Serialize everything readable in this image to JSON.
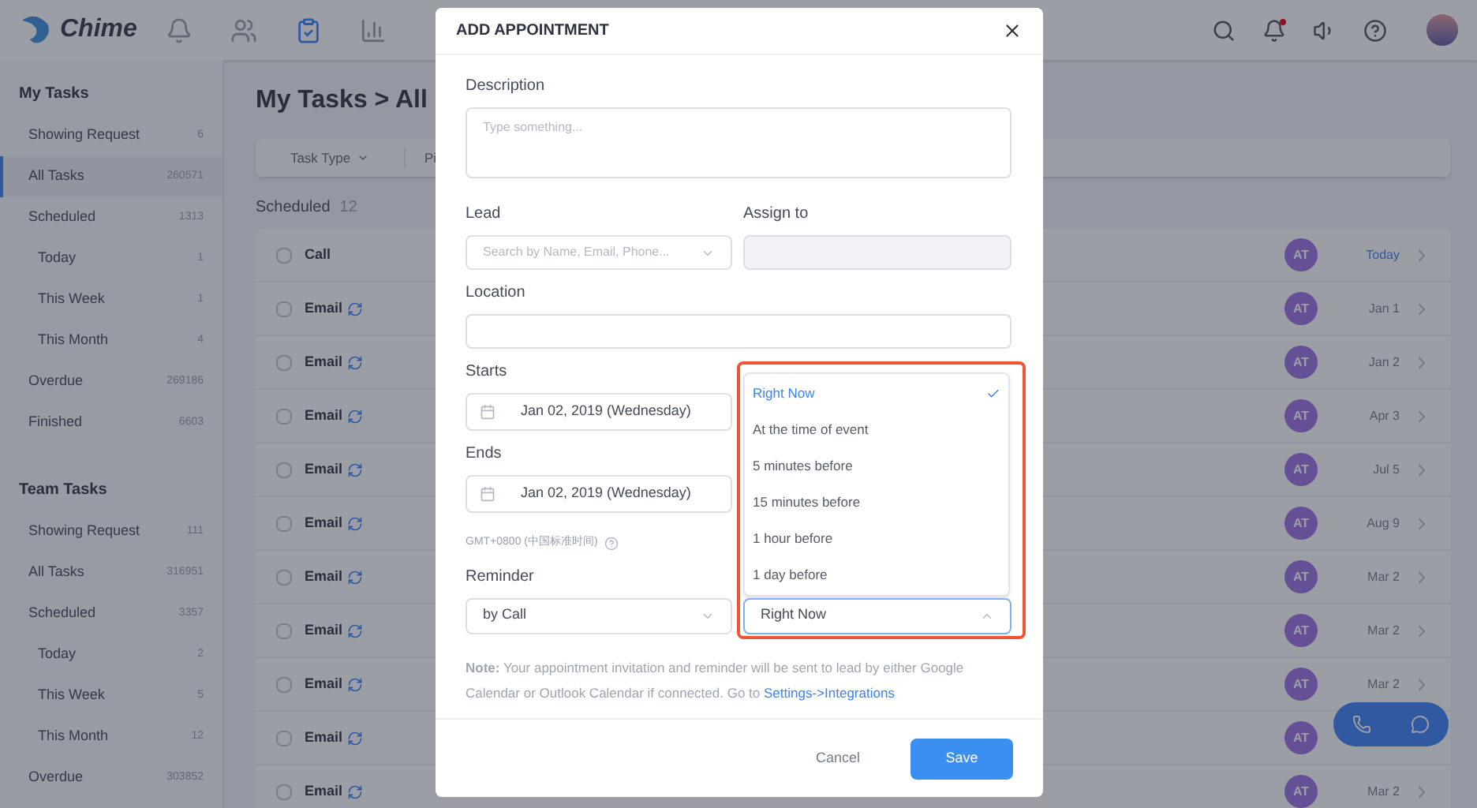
{
  "app": {
    "logo": "Chime",
    "nav": [
      {
        "selected": false
      },
      {
        "selected": false
      },
      {
        "selected": true
      },
      {
        "selected": false
      }
    ],
    "has_unread_notifications": true
  },
  "sidebar": [
    {
      "title": "My Tasks",
      "items": [
        {
          "label": "Showing Request",
          "count": "6",
          "selected": false
        },
        {
          "label": "All Tasks",
          "count": "260571",
          "selected": true
        },
        {
          "label": "Scheduled",
          "count": "1313",
          "selected": false,
          "children": [
            {
              "label": "Today",
              "count": "1",
              "selected": false
            },
            {
              "label": "This Week",
              "count": "1",
              "selected": false
            },
            {
              "label": "This Month",
              "count": "4",
              "selected": false
            }
          ]
        },
        {
          "label": "Overdue",
          "count": "269186",
          "selected": false
        },
        {
          "label": "Finished",
          "count": "6603",
          "selected": false
        }
      ]
    },
    {
      "title": "Team Tasks",
      "items": [
        {
          "label": "Showing Request",
          "count": "111",
          "selected": false
        },
        {
          "label": "All Tasks",
          "count": "316951",
          "selected": false
        },
        {
          "label": "Scheduled",
          "count": "3357",
          "selected": false,
          "children": [
            {
              "label": "Today",
              "count": "2",
              "selected": false
            },
            {
              "label": "This Week",
              "count": "5",
              "selected": false
            },
            {
              "label": "This Month",
              "count": "12",
              "selected": false
            }
          ]
        },
        {
          "label": "Overdue",
          "count": "303852",
          "selected": false
        }
      ]
    }
  ],
  "main": {
    "title": "My Tasks > All",
    "filters": [
      "Task Type",
      "Pi"
    ],
    "group": {
      "label": "Scheduled",
      "count": "12"
    },
    "rows": [
      {
        "type": "Call",
        "checked": false,
        "synced": false,
        "assignee": "AT",
        "date": "Today",
        "highlight": true
      },
      {
        "type": "Email",
        "checked": false,
        "synced": true,
        "assignee": "AT",
        "date": "Jan 1",
        "highlight": false
      },
      {
        "type": "Email",
        "checked": false,
        "synced": true,
        "assignee": "AT",
        "date": "Jan 2",
        "highlight": false
      },
      {
        "type": "Email",
        "checked": false,
        "synced": true,
        "assignee": "AT",
        "date": "Apr 3",
        "highlight": false
      },
      {
        "type": "Email",
        "checked": false,
        "synced": true,
        "assignee": "AT",
        "date": "Jul 5",
        "highlight": false
      },
      {
        "type": "Email",
        "checked": false,
        "synced": true,
        "assignee": "AT",
        "date": "Aug 9",
        "highlight": false
      },
      {
        "type": "Email",
        "checked": false,
        "synced": true,
        "assignee": "AT",
        "date": "Mar 2",
        "highlight": false
      },
      {
        "type": "Email",
        "checked": false,
        "synced": true,
        "assignee": "AT",
        "date": "Mar 2",
        "highlight": false
      },
      {
        "type": "Email",
        "checked": false,
        "synced": true,
        "assignee": "AT",
        "date": "Mar 2",
        "highlight": false
      },
      {
        "type": "Email",
        "checked": false,
        "synced": true,
        "assignee": "AT"
      },
      {
        "type": "Email",
        "checked": false,
        "synced": true,
        "assignee": "AT",
        "date": "Mar 2",
        "highlight": false
      }
    ]
  },
  "modal": {
    "title": "ADD APPOINTMENT",
    "description": {
      "label": "Description",
      "placeholder": "Type something..."
    },
    "lead": {
      "label": "Lead",
      "placeholder": "Search by Name, Email, Phone..."
    },
    "assign_to": {
      "label": "Assign to",
      "disabled": true
    },
    "location": {
      "label": "Location"
    },
    "starts": {
      "label": "Starts",
      "value": "Jan 02, 2019 (Wednesday)"
    },
    "ends": {
      "label": "Ends",
      "value": "Jan 02, 2019 (Wednesday)"
    },
    "timezone": "GMT+0800 (中国标准时间)",
    "reminder": {
      "label": "Reminder",
      "method": "by Call",
      "timing": "Right Now",
      "expanded": true,
      "options": [
        {
          "label": "Right Now",
          "selected": true
        },
        {
          "label": "At the time of event",
          "selected": false
        },
        {
          "label": "5 minutes before",
          "selected": false
        },
        {
          "label": "15 minutes before",
          "selected": false
        },
        {
          "label": "1 hour before",
          "selected": false
        },
        {
          "label": "1 day before",
          "selected": false
        }
      ]
    },
    "note": "**Note:** Your appointment invitation and reminder will be sent to lead by either Google Calendar or Outlook Calendar if connected. Go to",
    "note_link": "Settings->Integrations",
    "buttons": {
      "cancel": "Cancel",
      "save": "Save"
    }
  }
}
